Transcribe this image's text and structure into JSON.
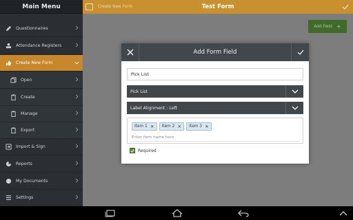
{
  "sidebar": {
    "title": "Main Menu",
    "items": [
      {
        "label": "Questionnaires",
        "icon": "pen-icon"
      },
      {
        "label": "Attendance Registers",
        "icon": "register-icon"
      },
      {
        "label": "Create New Form",
        "icon": "thumbs-up-icon",
        "active": true
      },
      {
        "label": "Open",
        "icon": "copy-icon",
        "sub": true
      },
      {
        "label": "Create",
        "icon": "clipboard-icon",
        "sub": true
      },
      {
        "label": "Manage",
        "icon": "clipboard-icon",
        "sub": true
      },
      {
        "label": "Export",
        "icon": "clipboard-icon",
        "sub": true
      },
      {
        "label": "Import & Sign",
        "icon": "import-icon"
      },
      {
        "label": "Reports",
        "icon": "pie-chart-icon"
      },
      {
        "label": "My Documents",
        "icon": "globe-icon"
      },
      {
        "label": "Settings",
        "icon": "menu-lines-icon"
      }
    ]
  },
  "topbar": {
    "breadcrumb": "Create New Form",
    "title": "Test Form"
  },
  "toolbar": {
    "add_field_label": "Add Field",
    "add_field_plus": "+"
  },
  "dialog": {
    "title": "Add Form Field",
    "field_name_value": "Pick List",
    "field_type_value": "Pick List",
    "label_alignment_value": "Label Alignment : Left",
    "items": [
      "Item 1",
      "Item 2",
      "Item 3"
    ],
    "item_input_placeholder": "Enter item name here",
    "required_label": "Required",
    "required_checked": true
  },
  "colors": {
    "accent": "#c8902e",
    "sidebar_bg": "#2b2f33",
    "dialog_header": "#42474c",
    "add_button": "#3f6a2a"
  }
}
